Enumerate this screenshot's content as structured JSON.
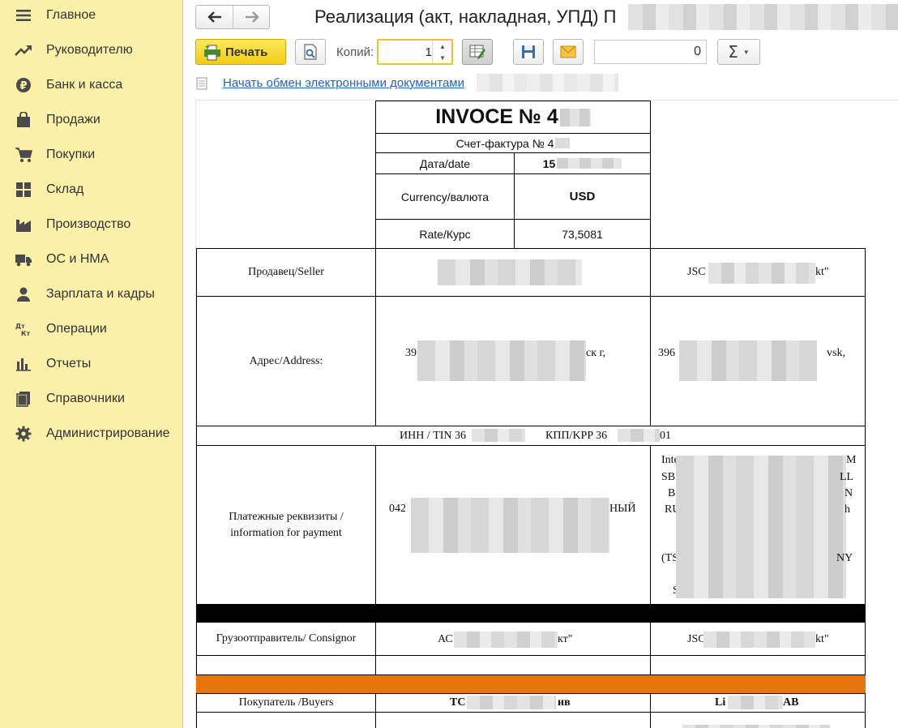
{
  "sidebar": {
    "items": [
      {
        "label": "Главное",
        "icon": "menu-icon"
      },
      {
        "label": "Руководителю",
        "icon": "trend-icon"
      },
      {
        "label": "Банк и касса",
        "icon": "ruble-icon"
      },
      {
        "label": "Продажи",
        "icon": "bag-icon"
      },
      {
        "label": "Покупки",
        "icon": "cart-icon"
      },
      {
        "label": "Склад",
        "icon": "warehouse-icon"
      },
      {
        "label": "Производство",
        "icon": "factory-icon"
      },
      {
        "label": "ОС и НМА",
        "icon": "truck-icon"
      },
      {
        "label": "Зарплата и кадры",
        "icon": "person-icon"
      },
      {
        "label": "Операции",
        "icon": "debit-credit-icon"
      },
      {
        "label": "Отчеты",
        "icon": "bar-chart-icon"
      },
      {
        "label": "Справочники",
        "icon": "books-icon"
      },
      {
        "label": "Администрирование",
        "icon": "gear-icon"
      }
    ]
  },
  "header": {
    "title": "Реализация (акт, накладная, УПД) П"
  },
  "toolbar": {
    "print_label": "Печать",
    "copies_label": "Копий:",
    "copies_value": "1",
    "sum_value": "0"
  },
  "edo": {
    "link_text": "Начать обмен электронными документами"
  },
  "document": {
    "invoice_title": "INVOCE № 4",
    "schet_label": "Счет-фактура № 4",
    "date_label": "Дата/date",
    "date_value": "15",
    "currency_label": "Currency/валюта",
    "currency_value": "USD",
    "rate_label": "Rate/Курс",
    "rate_value": "73,5081",
    "seller_label": "Продавец/Seller",
    "seller_right": "JSC",
    "seller_right_end": "kt\"",
    "address_label": "Адрес/Address:",
    "address_mid_start": "39",
    "address_mid_end": "ск г,",
    "address_right_start": "396",
    "address_right_end": "vsk,",
    "inn_label": "ИНН / TIN 36",
    "kpp_label": "КПП/KPP 36",
    "kpp_end": "01",
    "payment_label_1": "Платежные реквизиты /",
    "payment_label_2": "information for payment",
    "payment_mid_start": "042",
    "payment_mid_end": "НЫЙ",
    "payment_right_lines": [
      "Inte",
      "SBI",
      "B",
      "RU",
      "(TS",
      "S"
    ],
    "payment_right_ends": [
      "M",
      "LL",
      "N",
      "h",
      "NY",
      ""
    ],
    "consignor_label": "Грузоотправитель/ Consignor",
    "consignor_mid_start": "АС",
    "consignor_mid_end": "кт\"",
    "consignor_right_start": "JSC",
    "consignor_right_end": "kt\"",
    "buyers_label": "Покупатель /Buyers",
    "buyers_mid_start": "ТС",
    "buyers_mid_end": "ив",
    "buyers_right_start": "Li",
    "buyers_right_end": "AB"
  }
}
